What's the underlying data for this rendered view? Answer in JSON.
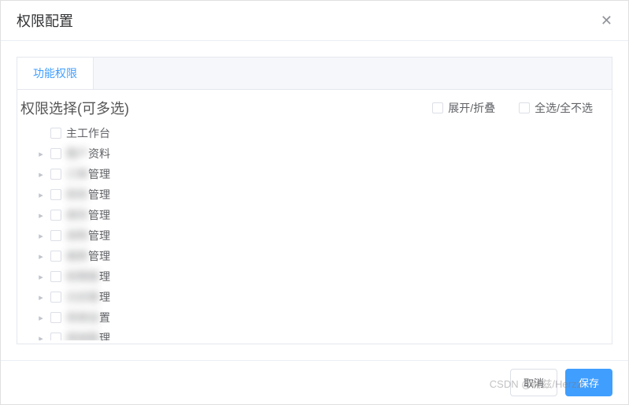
{
  "dialog": {
    "title": "权限配置"
  },
  "tabs": {
    "active": "功能权限"
  },
  "section": {
    "title": "权限选择(可多选)"
  },
  "controls": {
    "expand_collapse": "展开/折叠",
    "select_all": "全选/全不选"
  },
  "tree": [
    {
      "label": "主工作台",
      "expandable": false,
      "blurred": false
    },
    {
      "label": "客户资料",
      "expandable": true,
      "blurred": true,
      "suffix": "资料"
    },
    {
      "label": "订单管理",
      "expandable": true,
      "blurred": true,
      "suffix": "管理"
    },
    {
      "label": "财务管理",
      "expandable": true,
      "blurred": true,
      "suffix": "管理"
    },
    {
      "label": "库存管理",
      "expandable": true,
      "blurred": true,
      "suffix": "管理"
    },
    {
      "label": "采购管理",
      "expandable": true,
      "blurred": true,
      "suffix": "管理"
    },
    {
      "label": "报表管理",
      "expandable": true,
      "blurred": true,
      "suffix": "管理"
    },
    {
      "label": "权限管理",
      "expandable": true,
      "blurred": true,
      "suffix": "理"
    },
    {
      "label": "日志管理",
      "expandable": true,
      "blurred": true,
      "suffix": "理"
    },
    {
      "label": "系统设置",
      "expandable": true,
      "blurred": true,
      "suffix": "置"
    },
    {
      "label": "其他管理",
      "expandable": true,
      "blurred": true,
      "suffix": "理"
    }
  ],
  "footer": {
    "cancel": "取消",
    "save": "保存"
  },
  "watermark": "CSDN @赫兹/Herzz"
}
